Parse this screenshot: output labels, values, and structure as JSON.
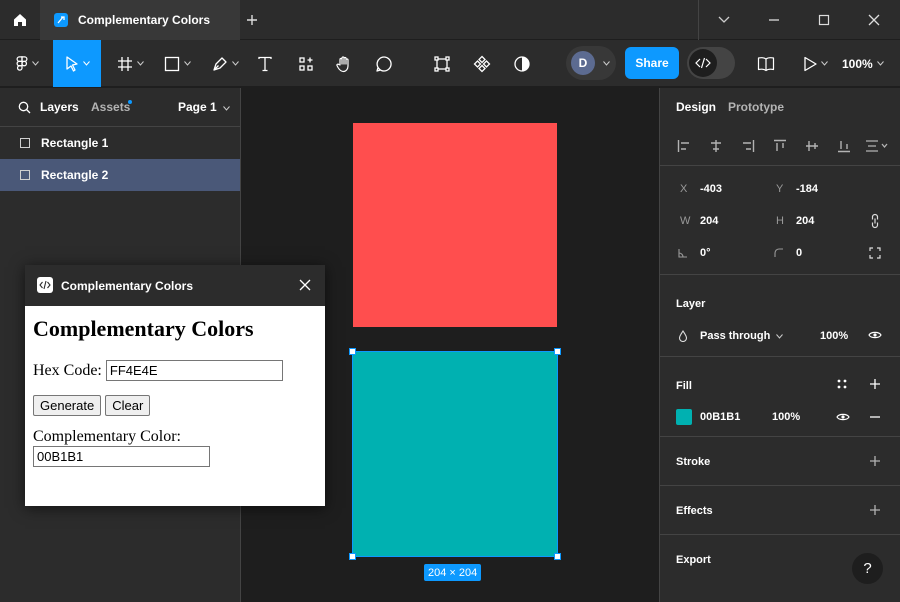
{
  "titlebar": {
    "tab_title": "Complementary Colors"
  },
  "toolbar": {
    "avatar_initial": "D",
    "share_label": "Share",
    "zoom": "100%"
  },
  "left_panel": {
    "tab_layers": "Layers",
    "tab_assets": "Assets",
    "page_selector": "Page 1",
    "layers": [
      {
        "label": "Rectangle 1",
        "selected": false
      },
      {
        "label": "Rectangle 2",
        "selected": true
      }
    ]
  },
  "canvas": {
    "rect1_color": "#FF4E4E",
    "rect2_color": "#00B1B1",
    "selection_size": "204 × 204"
  },
  "plugin": {
    "window_title": "Complementary Colors",
    "heading": "Complementary Colors",
    "hex_label": "Hex Code:",
    "hex_value": "FF4E4E",
    "generate_label": "Generate",
    "clear_label": "Clear",
    "result_label": "Complementary Color:",
    "result_value": "00B1B1"
  },
  "right_panel": {
    "tab_design": "Design",
    "tab_prototype": "Prototype",
    "x_label": "X",
    "x_value": "-403",
    "y_label": "Y",
    "y_value": "-184",
    "w_label": "W",
    "w_value": "204",
    "h_label": "H",
    "h_value": "204",
    "rotation_value": "0°",
    "radius_value": "0",
    "layer_title": "Layer",
    "blend_mode": "Pass through",
    "layer_opacity": "100%",
    "fill_title": "Fill",
    "fill_hex": "00B1B1",
    "fill_color": "#00B1B1",
    "fill_opacity": "100%",
    "stroke_title": "Stroke",
    "effects_title": "Effects",
    "export_title": "Export",
    "help_label": "?"
  }
}
